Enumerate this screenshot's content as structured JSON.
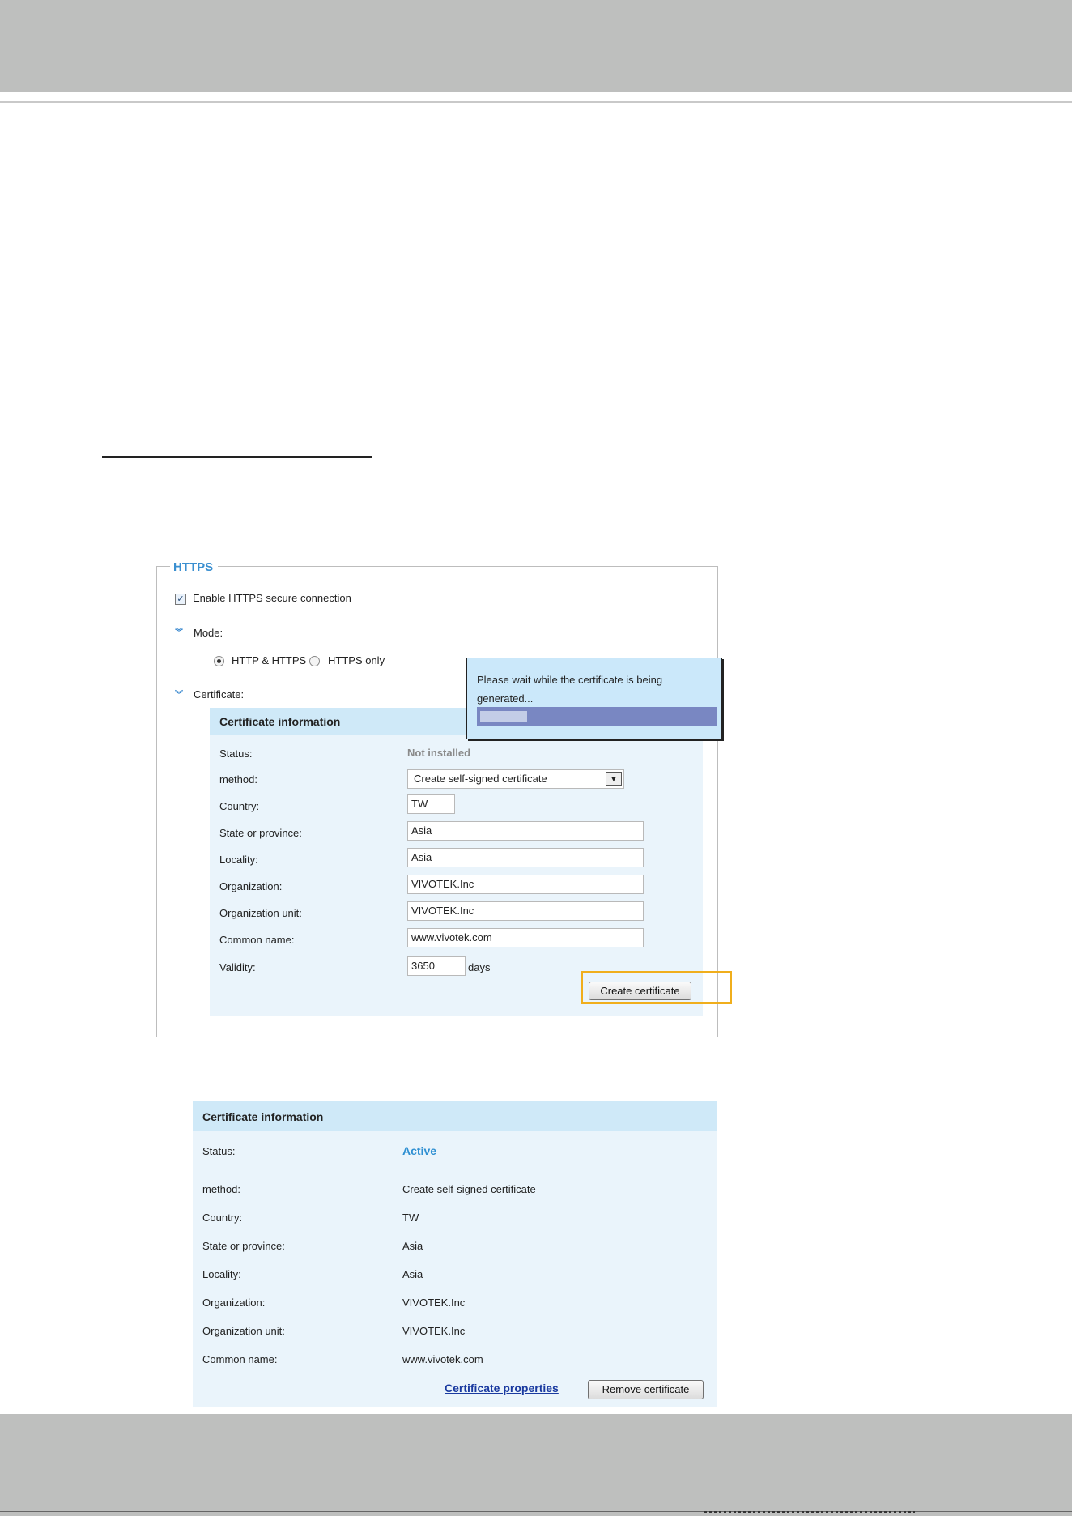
{
  "https": {
    "legend": "HTTPS",
    "enable_label": "Enable HTTPS secure connection",
    "enable_checked": true,
    "mode_label": "Mode:",
    "mode_options": [
      "HTTP & HTTPS",
      "HTTPS only"
    ],
    "mode_selected": "HTTP & HTTPS",
    "certificate_label": "Certificate:"
  },
  "cert_form": {
    "title": "Certificate information",
    "status_label": "Status:",
    "status_value": "Not installed",
    "method_label": "method:",
    "method_value": "Create self-signed certificate",
    "country_label": "Country:",
    "country_value": "TW",
    "state_label": "State or province:",
    "state_value": "Asia",
    "locality_label": "Locality:",
    "locality_value": "Asia",
    "org_label": "Organization:",
    "org_value": "VIVOTEK.Inc",
    "org_unit_label": "Organization unit:",
    "org_unit_value": "VIVOTEK.Inc",
    "common_name_label": "Common name:",
    "common_name_value": "www.vivotek.com",
    "validity_label": "Validity:",
    "validity_value": "3650",
    "validity_unit": "days",
    "create_button": "Create certificate"
  },
  "popup": {
    "message": "Please wait while the certificate is being generated...",
    "progress": 0.2
  },
  "cert_info": {
    "title": "Certificate information",
    "status_label": "Status:",
    "status_value": "Active",
    "method_label": "method:",
    "method_value": "Create self-signed certificate",
    "country_label": "Country:",
    "country_value": "TW",
    "state_label": "State or province:",
    "state_value": "Asia",
    "locality_label": "Locality:",
    "locality_value": "Asia",
    "org_label": "Organization:",
    "org_value": "VIVOTEK.Inc",
    "org_unit_label": "Organization unit:",
    "org_unit_value": "VIVOTEK.Inc",
    "common_name_label": "Common name:",
    "common_name_value": "www.vivotek.com",
    "properties_link": "Certificate properties",
    "remove_button": "Remove certificate"
  },
  "colors": {
    "accent": "#3a8fd0",
    "active_status": "#2e8fd2",
    "panel_bg": "#eaf4fb",
    "panel_header": "#cfe9f8",
    "highlight": "#f0ae1c",
    "band": "#bebfbe"
  }
}
